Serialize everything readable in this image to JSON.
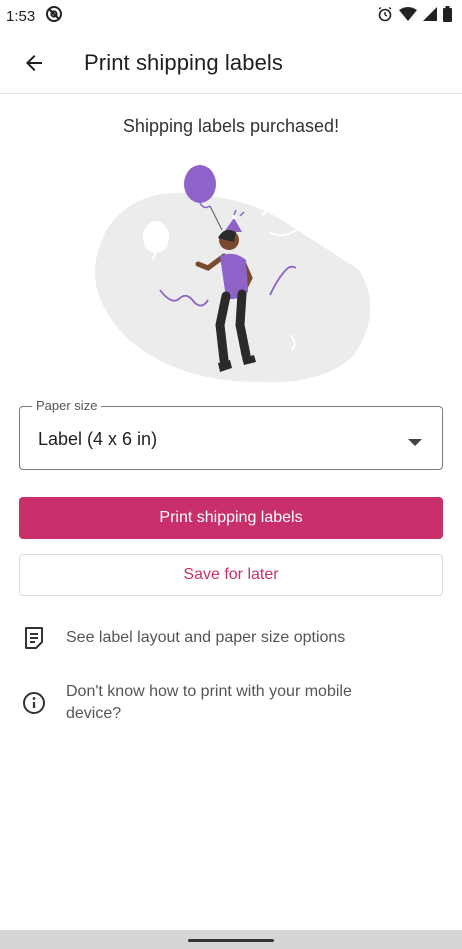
{
  "status_bar": {
    "time": "1:53",
    "icons": [
      "at-sign-icon",
      "alarm-icon",
      "wifi-icon",
      "signal-icon",
      "battery-icon"
    ]
  },
  "app_bar": {
    "title": "Print shipping labels",
    "back_icon": "back-arrow-icon"
  },
  "content": {
    "success_message": "Shipping labels purchased!",
    "illustration": "celebration-illustration",
    "paper_size": {
      "label": "Paper size",
      "value": "Label (4 x 6 in)"
    },
    "primary_button": "Print shipping labels",
    "secondary_button": "Save for later",
    "info_rows": [
      {
        "icon": "document-icon",
        "text": "See label layout and paper size options"
      },
      {
        "icon": "info-icon",
        "text": "Don't know how to print with your mobile device?"
      }
    ]
  },
  "colors": {
    "accent": "#c9306b",
    "illustration_purple": "#8e63c9",
    "blob": "#ececec"
  }
}
